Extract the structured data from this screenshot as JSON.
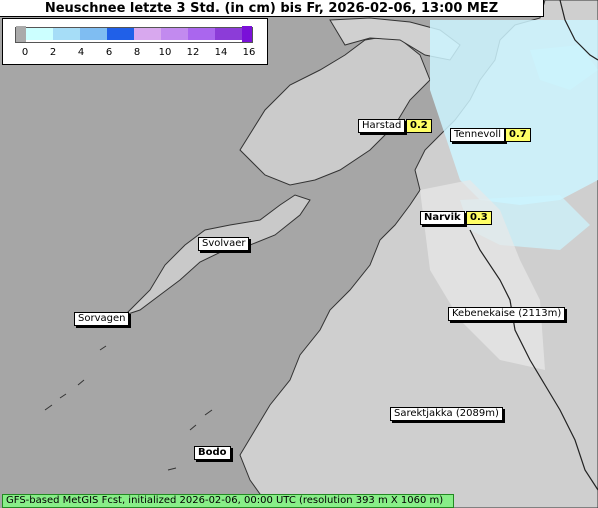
{
  "title": "Neuschnee letzte 3 Std. (in cm) bis Fr, 2026-02-06, 13:00 MEZ",
  "legend": {
    "tick_labels": [
      "0",
      "2",
      "4",
      "6",
      "8",
      "10",
      "12",
      "14",
      "16"
    ],
    "colors": [
      "#aaaaaa",
      "#ccffff",
      "#a6ddf7",
      "#7fbdf2",
      "#5294ee",
      "#2060e8",
      "#d8a8ee",
      "#c28aef",
      "#aa66ee",
      "#8c3cd8",
      "#7a10d8"
    ]
  },
  "places": {
    "harstad": {
      "name": "Harstad",
      "value": "0.2"
    },
    "tennevoll": {
      "name": "Tennevoll",
      "value": "0.7"
    },
    "narvik": {
      "name": "Narvik",
      "value": "0.3"
    },
    "svolvaer": {
      "name": "Svolvaer"
    },
    "sorvagen": {
      "name": "Sorvagen"
    },
    "kebnekaise": {
      "name": "Kebenekaise (2113m)"
    },
    "sarektjakka": {
      "name": "Sarektjakka (2089m)"
    },
    "bodo": {
      "name": "Bodo"
    }
  },
  "footer": "GFS-based MetGIS Fcst, initialized 2026-02-06, 00:00 UTC  (resolution 393 m X 1060 m)",
  "colors": {
    "sea": "#a6a6a6",
    "land": "#d4d4d4",
    "snow_light": "#ccf5ff",
    "value_bg": "#ffff66",
    "footer_bg": "#88ee88"
  }
}
